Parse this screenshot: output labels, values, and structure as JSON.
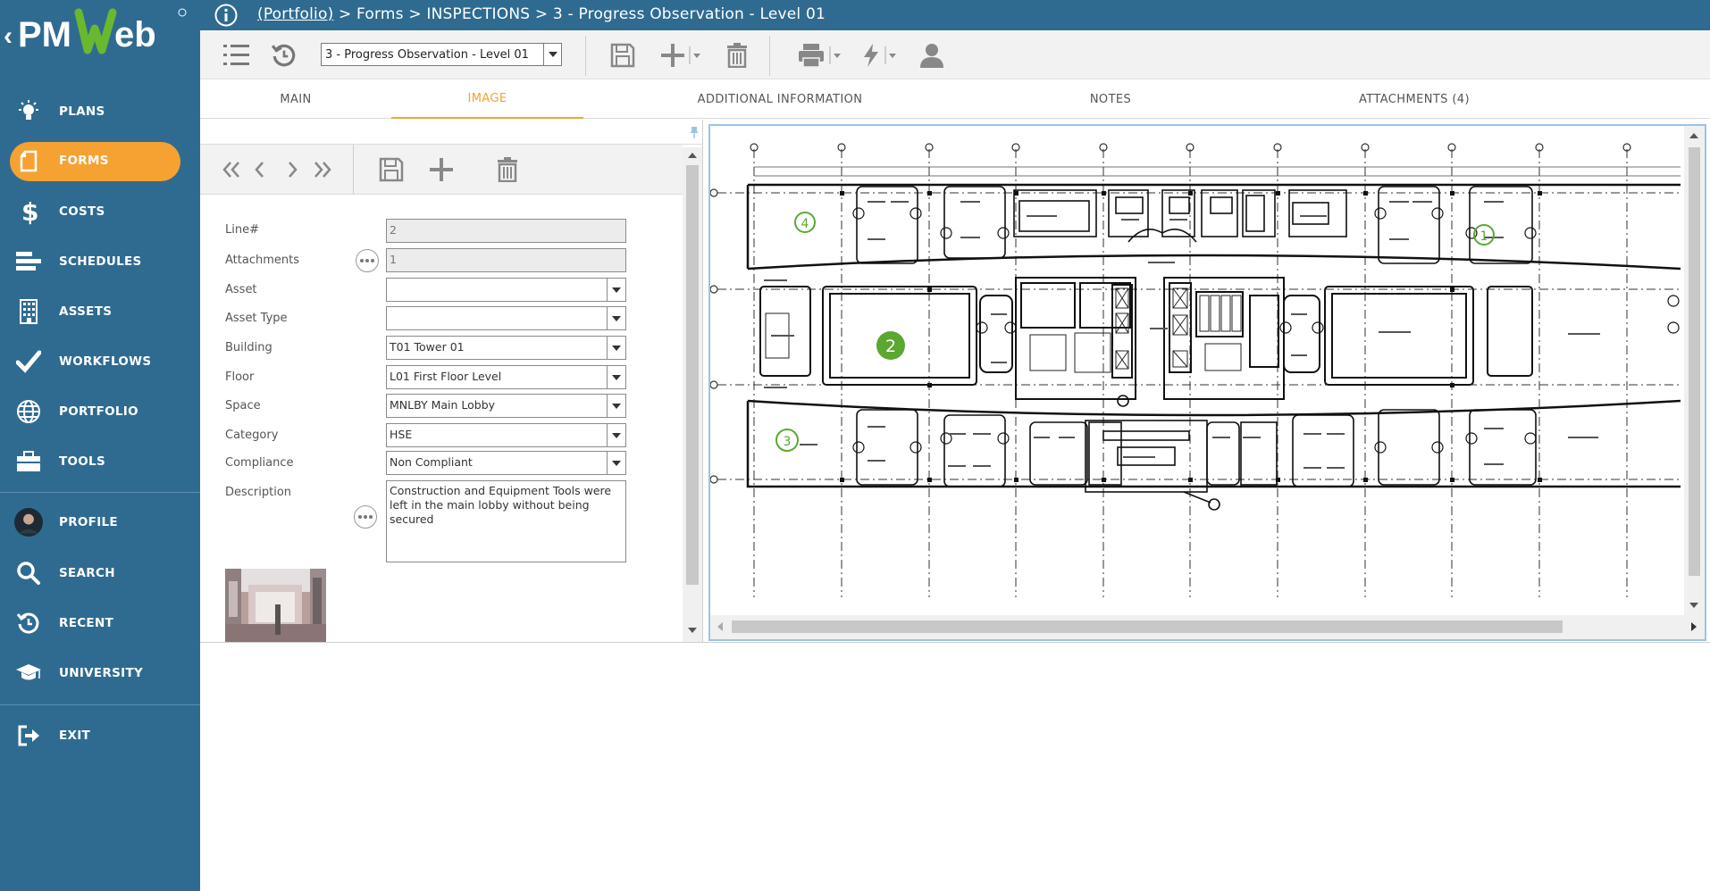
{
  "app": {
    "logo_text": "PMWeb"
  },
  "breadcrumb": {
    "portfolio": "(Portfolio)",
    "rest": " > Forms > INSPECTIONS > 3 - Progress Observation - Level 01"
  },
  "sidebar": {
    "items": [
      {
        "label": "PLANS",
        "icon": "lightbulb-icon"
      },
      {
        "label": "FORMS",
        "icon": "document-icon",
        "active": true
      },
      {
        "label": "COSTS",
        "icon": "dollar-icon"
      },
      {
        "label": "SCHEDULES",
        "icon": "schedule-bars-icon"
      },
      {
        "label": "ASSETS",
        "icon": "building-icon"
      },
      {
        "label": "WORKFLOWS",
        "icon": "checkmark-icon"
      },
      {
        "label": "PORTFOLIO",
        "icon": "globe-icon"
      },
      {
        "label": "TOOLS",
        "icon": "toolbox-icon"
      },
      {
        "label": "PROFILE",
        "icon": "avatar-icon"
      },
      {
        "label": "SEARCH",
        "icon": "search-icon"
      },
      {
        "label": "RECENT",
        "icon": "history-icon"
      },
      {
        "label": "UNIVERSITY",
        "icon": "graduation-cap-icon"
      },
      {
        "label": "EXIT",
        "icon": "exit-icon"
      }
    ]
  },
  "toolbar": {
    "record_select_value": "3 - Progress Observation - Level 01"
  },
  "tabs": [
    {
      "label": "MAIN"
    },
    {
      "label": "IMAGE",
      "active": true
    },
    {
      "label": "ADDITIONAL INFORMATION"
    },
    {
      "label": "NOTES"
    },
    {
      "label": "ATTACHMENTS (4)"
    }
  ],
  "form": {
    "fields": [
      {
        "label": "Line#",
        "value": "2"
      },
      {
        "label": "Attachments",
        "value": "1"
      },
      {
        "label": "Asset",
        "value": ""
      },
      {
        "label": "Asset Type",
        "value": ""
      },
      {
        "label": "Building",
        "value": "T01 Tower 01"
      },
      {
        "label": "Floor",
        "value": "L01 First Floor Level"
      },
      {
        "label": "Space",
        "value": "MNLBY Main Lobby"
      },
      {
        "label": "Category",
        "value": "HSE"
      },
      {
        "label": "Compliance",
        "value": "Non Compliant"
      }
    ],
    "description_label": "Description",
    "description_value": "Construction and Equipment Tools were left in the main lobby without being secured"
  },
  "viewer": {
    "markers": [
      {
        "label": "2",
        "kind": "selected"
      },
      {
        "label": "4",
        "kind": "outline"
      },
      {
        "label": "1",
        "kind": "outline"
      },
      {
        "label": "3",
        "kind": "outline"
      }
    ],
    "marker_color": "#5aa832"
  },
  "colors": {
    "sidebar_bg": "#2f6b91",
    "accent": "#f5a233",
    "viewer_border": "#9cc3e6"
  }
}
